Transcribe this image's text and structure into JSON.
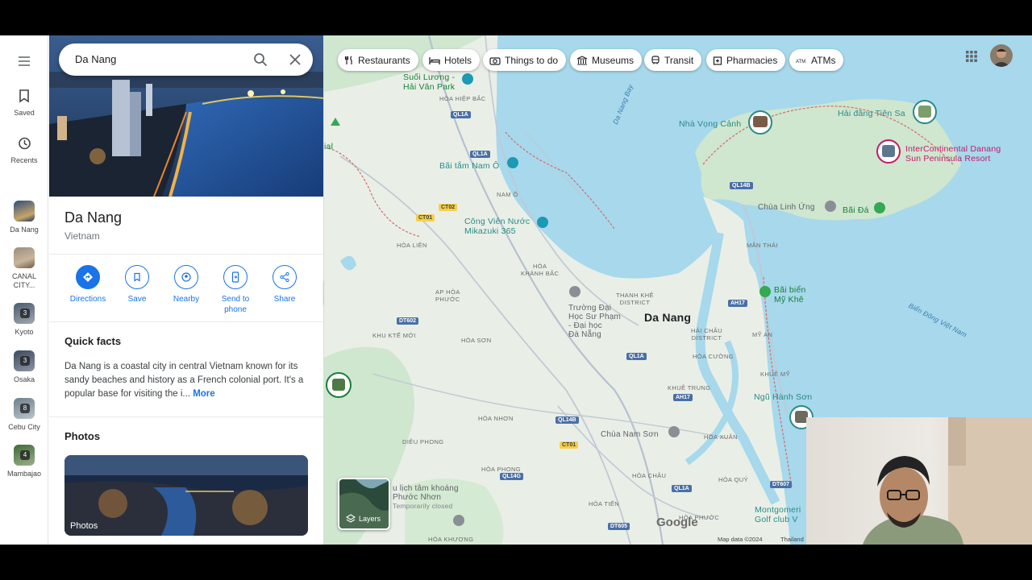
{
  "rail": {
    "saved": "Saved",
    "recents": "Recents",
    "items": [
      {
        "label": "Da Nang",
        "badge": ""
      },
      {
        "label": "CANAL CITY...",
        "badge": ""
      },
      {
        "label": "Kyoto",
        "badge": "3"
      },
      {
        "label": "Osaka",
        "badge": "3"
      },
      {
        "label": "Cebu City",
        "badge": "8"
      },
      {
        "label": "Mambajao",
        "badge": "4"
      }
    ]
  },
  "search": {
    "value": "Da Nang"
  },
  "place": {
    "title": "Da Nang",
    "subtitle": "Vietnam"
  },
  "actions": {
    "directions": "Directions",
    "save": "Save",
    "nearby": "Nearby",
    "send_line1": "Send to",
    "send_line2": "phone",
    "share": "Share"
  },
  "quick_facts": {
    "title": "Quick facts",
    "body": "Da Nang is a coastal city in central Vietnam known for its sandy beaches and history as a French colonial port. It's a popular base for visiting the i...",
    "more": "More"
  },
  "photos": {
    "title": "Photos",
    "card_label": "Photos"
  },
  "chips": [
    "Restaurants",
    "Hotels",
    "Things to do",
    "Museums",
    "Transit",
    "Pharmacies",
    "ATMs"
  ],
  "map": {
    "city": "Da Nang",
    "layers": "Layers",
    "attribution": "Map data ©2024",
    "region": "Thailand",
    "logo": "Google",
    "places": {
      "suoi_luong": "Suối Lương -",
      "hai_van_park": "Hải Vân Park",
      "nha_vong_canh": "Nhà Vọng Cảnh",
      "hai_dang": "Hải đăng Tiên Sa",
      "intercon_1": "InterContinental Danang",
      "intercon_2": "Sun Peninsula Resort",
      "bai_tam": "Bãi tắm Nam Ô",
      "cong_vien_1": "Công Viên Nước",
      "cong_vien_2": "Mikazuki 365",
      "chua_linh_ung": "Chùa Linh Ứng",
      "bai_da": "Bãi Đá",
      "bai_bien_1": "Bãi biển",
      "bai_bien_2": "Mỹ Khê",
      "truong_1": "Trường Đại",
      "truong_2": "Học Sư Phạm",
      "truong_3": "- Đại học",
      "truong_4": "Đà Nẵng",
      "ngu_hanh_son": "Ngũ Hành Sơn",
      "chua_nam_son": "Chùa Nam Sơn",
      "khu_du_lich_1": "u lịch tâm khoáng",
      "khu_du_lich_2": "Phước Nhơn",
      "temp_closed": "Temporarily closed",
      "montgomerie_1": "Montgomeri",
      "montgomerie_2": "Golf club V",
      "dial": "ial"
    },
    "water": {
      "bay": "Da Nang Bay",
      "sea": "Biển Đông Việt Nam"
    },
    "districts": {
      "hoa_hiep_bac": "HÒA HIỆP BẮC",
      "nam_o": "NAM Ô",
      "hoa_lien": "HÒA LIÊN",
      "hoa_khanh_bac": "HÒA\nKHÁNH BẮC",
      "ap_hoa_phuoc": "AP HÒA\nPHƯỚC",
      "khu_kte_moi": "KHU KTẾ MỚI",
      "hoa_son": "HÒA SƠN",
      "thanh_khe": "THANH KHÊ\nDISTRICT",
      "man_thai": "MÂN THÁI",
      "hai_chau": "HẢI CHÂU\nDISTRICT",
      "my_an": "MỸ AN",
      "hoa_cuong": "HÒA CƯỜNG",
      "khue_my": "KHUÊ MỸ",
      "khue_trung": "KHUÊ TRUNG",
      "hoa_nhon": "HÒA NHƠN",
      "dieu_phong": "DIÊU PHONG",
      "hoa_xuan": "HÒA XUÂN",
      "hoa_phong": "HÒA PHONG",
      "hoa_chau": "HÒA CHÂU",
      "hoa_quy": "HÒA QUÝ",
      "hoa_tien": "HÒA TIẾN",
      "hoa_phuoc": "HÒA PHƯỚC",
      "hoa_khuong": "HÒA KHƯƠNG"
    },
    "roads": [
      "QL1A",
      "QL1A",
      "QL14B",
      "CT02",
      "CT01",
      "DT602",
      "QL1A",
      "AH17",
      "AH17",
      "QL14B",
      "CT01",
      "QL14G",
      "DT605",
      "QL1A",
      "DT607"
    ]
  }
}
